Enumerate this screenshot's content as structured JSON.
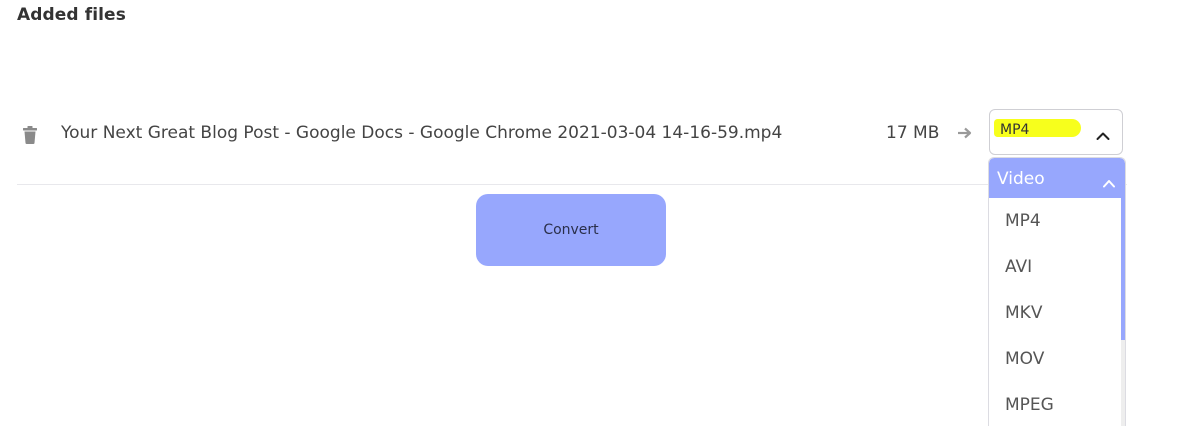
{
  "section": {
    "title": "Added files"
  },
  "file": {
    "name": "Your Next Great Blog Post - Google Docs - Google Chrome 2021-03-04 14-16-59.mp4",
    "size": "17 MB",
    "selected_format": "MP4"
  },
  "actions": {
    "convert_label": "Convert"
  },
  "dropdown": {
    "category": "Video",
    "options": [
      "MP4",
      "AVI",
      "MKV",
      "MOV",
      "MPEG"
    ]
  },
  "colors": {
    "accent": "#97a7fd",
    "highlight": "#f7ff1c",
    "text": "#444444"
  },
  "icons": {
    "delete": "trash-icon",
    "convert_to": "arrow-right-icon",
    "select_toggle": "chevron-up-icon"
  }
}
